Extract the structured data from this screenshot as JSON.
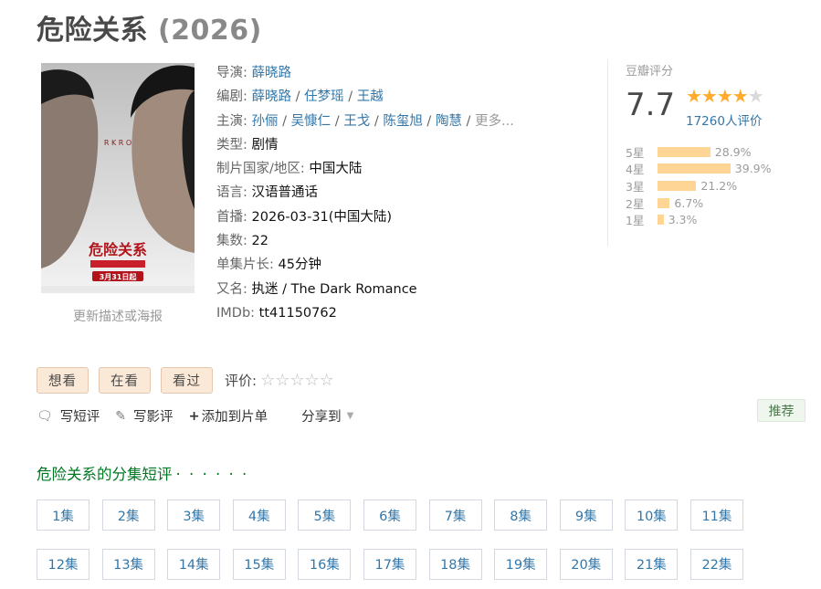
{
  "title": {
    "name": "危险关系",
    "year": "(2026)"
  },
  "poster": {
    "update_link": "更新描述或海报",
    "poster_title": "危险关系",
    "poster_date": "3月31日起"
  },
  "info": {
    "director": {
      "label": "导演:",
      "names": [
        "薛晓路"
      ]
    },
    "writer": {
      "label": "编剧:",
      "names": [
        "薛晓路",
        "任梦瑶",
        "王越"
      ]
    },
    "cast": {
      "label": "主演:",
      "names": [
        "孙俪",
        "吴慷仁",
        "王戈",
        "陈玺旭",
        "陶慧"
      ],
      "more": "更多..."
    },
    "genre": {
      "label": "类型:",
      "value": "剧情"
    },
    "country": {
      "label": "制片国家/地区:",
      "value": "中国大陆"
    },
    "language": {
      "label": "语言:",
      "value": "汉语普通话"
    },
    "premiere": {
      "label": "首播:",
      "value": "2026-03-31(中国大陆)"
    },
    "episodes": {
      "label": "集数:",
      "value": "22"
    },
    "runtime": {
      "label": "单集片长:",
      "value": "45分钟"
    },
    "aka": {
      "label": "又名:",
      "value": "执迷 / The Dark Romance"
    },
    "imdb": {
      "label": "IMDb:",
      "value": "tt41150762"
    }
  },
  "rating": {
    "label": "豆瓣评分",
    "score": "7.7",
    "stars_filled": 4,
    "stars_total": 5,
    "votes": "17260人评价",
    "distribution": [
      {
        "star": "5星",
        "pct": "28.9%",
        "value": 28.9
      },
      {
        "star": "4星",
        "pct": "39.9%",
        "value": 39.9
      },
      {
        "star": "3星",
        "pct": "21.2%",
        "value": 21.2
      },
      {
        "star": "2星",
        "pct": "6.7%",
        "value": 6.7
      },
      {
        "star": "1星",
        "pct": "3.3%",
        "value": 3.3
      }
    ]
  },
  "actions": {
    "want": "想看",
    "watching": "在看",
    "watched": "看过",
    "rate_label": "评价:"
  },
  "tools": {
    "short_review": "写短评",
    "review": "写影评",
    "add_list": "添加到片单",
    "share": "分享到"
  },
  "recommend": "推荐",
  "section": {
    "title": "危险关系的分集短评",
    "dots": "· · · · · ·"
  },
  "episodes": [
    "1集",
    "2集",
    "3集",
    "4集",
    "5集",
    "6集",
    "7集",
    "8集",
    "9集",
    "10集",
    "11集",
    "12集",
    "13集",
    "14集",
    "15集",
    "16集",
    "17集",
    "18集",
    "19集",
    "20集",
    "21集",
    "22集"
  ]
}
